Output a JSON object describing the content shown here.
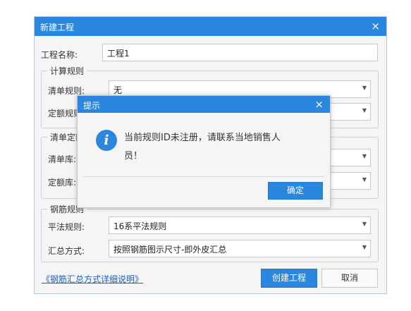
{
  "main_dialog": {
    "title": "新建工程",
    "close_glyph": "×",
    "project_name_label": "工程名称:",
    "project_name_value": "工程1",
    "calc_rules": {
      "legend": "计算规则",
      "bill_rule_label": "清单规则:",
      "bill_rule_value": "无",
      "quota_rule_label": "定额规则"
    },
    "bill_quota": {
      "legend": "清单定额",
      "bill_lib_label": "清单库:",
      "quota_lib_label": "定额库:"
    },
    "rebar_rules": {
      "legend": "钢筋规则",
      "flat_rule_label": "平法规则:",
      "flat_rule_value": "16系平法规则",
      "summary_label": "汇总方式:",
      "summary_value": "按照钢筋图示尺寸-即外皮汇总"
    },
    "help_link": "《钢筋汇总方式详细说明》",
    "create_button": "创建工程",
    "cancel_button": "取消"
  },
  "alert_dialog": {
    "title": "提示",
    "close_glyph": "×",
    "icon": "info-icon",
    "icon_glyph": "i",
    "message_line1": "当前规则ID未注册，请联系当地销售人",
    "message_line2": "员！",
    "ok_button": "确定"
  },
  "colors": {
    "accent": "#2b86dd",
    "link": "#1f5fc0",
    "dialog_bg": "#f5f5f5"
  }
}
